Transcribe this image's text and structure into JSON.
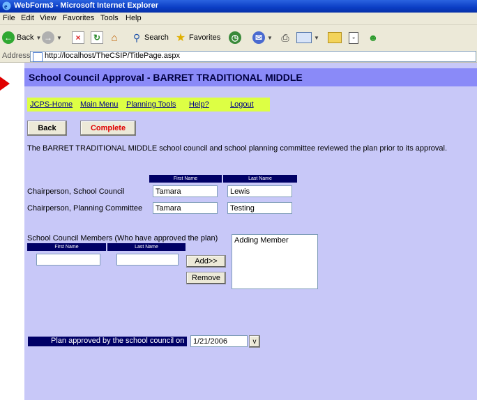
{
  "window": {
    "title": "WebForm3 - Microsoft Internet Explorer"
  },
  "menu": [
    "File",
    "Edit",
    "View",
    "Favorites",
    "Tools",
    "Help"
  ],
  "toolbar": {
    "back": "Back",
    "search": "Search",
    "favorites": "Favorites"
  },
  "address": {
    "label": "Address",
    "url": "http://localhost/TheCSIP/TitlePage.aspx"
  },
  "page": {
    "header": "School Council Approval - BARRET TRADITIONAL MIDDLE",
    "nav": [
      "JCPS-Home",
      "Main Menu",
      "Planning Tools",
      "Help?",
      "Logout"
    ],
    "buttons": {
      "back": "Back",
      "complete": "Complete"
    },
    "description": "The BARRET TRADITIONAL MIDDLE school council and school planning committee reviewed the plan prior to its approval.",
    "chair_table": {
      "col_first": "First Name",
      "col_last": "Last Name",
      "rows": [
        {
          "label": "Chairperson, School Council",
          "first": "Tamara",
          "last": "Lewis"
        },
        {
          "label": "Chairperson, Planning Committee",
          "first": "Tamara",
          "last": "Testing"
        }
      ]
    },
    "members": {
      "label": "School Council Members (Who have approved the plan)",
      "col_first": "First Name",
      "col_last": "Last Name",
      "add": "Add>>",
      "remove": "Remove",
      "list": [
        "Adding Member"
      ]
    },
    "approval": {
      "label": "Plan approved by the school council on",
      "date": "1/21/2006",
      "dropdown": "v"
    }
  }
}
